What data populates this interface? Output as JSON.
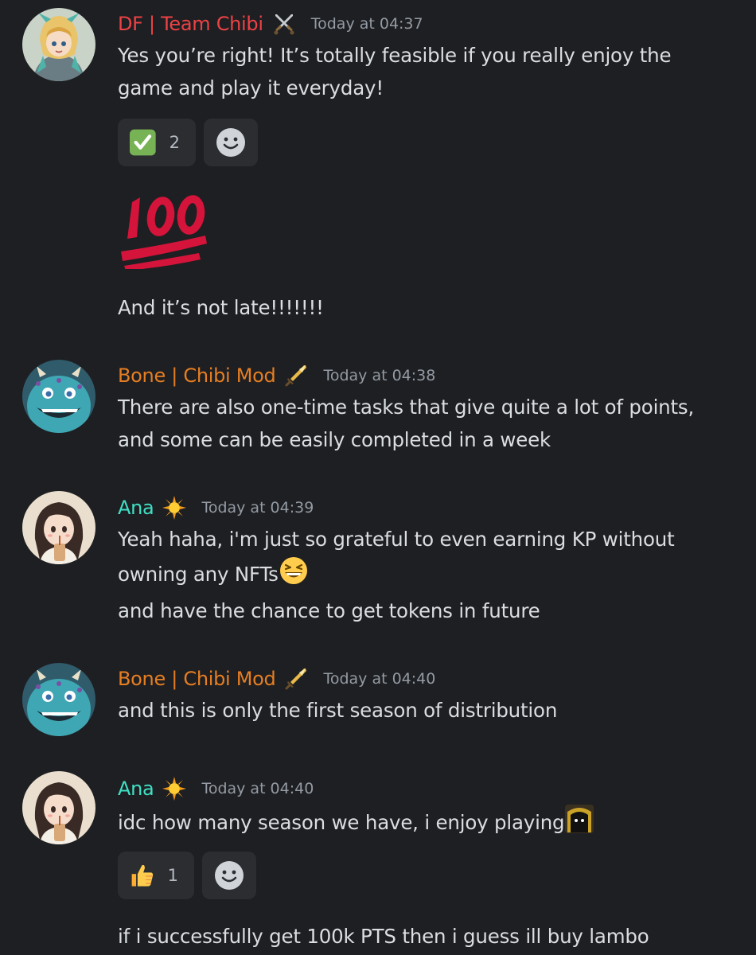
{
  "messages": [
    {
      "username": "DF | Team Chibi",
      "role_icon": "crossed-swords-icon",
      "username_color": "#ed4245",
      "timestamp": "Today at 04:37",
      "avatar": "valkyrie-warrior-avatar",
      "lines": [
        "Yes you’re right! It’s totally feasible if you really enjoy the",
        "game and play it everyday!"
      ],
      "reactions": [
        {
          "emoji": "check-mark-emoji",
          "count": "2"
        }
      ],
      "big_emoji": "hundred-points-emoji",
      "followup": "And it’s not late!!!!!!!"
    },
    {
      "username": "Bone | Chibi Mod",
      "role_icon": "sword-icon",
      "username_color": "#e67e22",
      "timestamp": "Today at 04:38",
      "avatar": "blue-monster-avatar",
      "lines": [
        "There are also one-time tasks that give quite a lot of points,",
        "and some can be easily completed in a week"
      ]
    },
    {
      "username": "Ana",
      "role_icon": "sun-icon",
      "username_color": "#3fe0c5",
      "timestamp": "Today at 04:39",
      "avatar": "anime-girl-avatar",
      "lines": [
        "Yeah haha, i'm just so grateful to even earning KP without",
        "owning any NFTs"
      ],
      "inline_emoji": "grinning-squinting-emoji",
      "followup": "and have the chance to get tokens in future"
    },
    {
      "username": "Bone | Chibi Mod",
      "role_icon": "sword-icon",
      "username_color": "#e67e22",
      "timestamp": "Today at 04:40",
      "avatar": "blue-monster-avatar",
      "lines": [
        "and this is only the first season of distribution"
      ]
    },
    {
      "username": "Ana",
      "role_icon": "sun-icon",
      "username_color": "#3fe0c5",
      "timestamp": "Today at 04:40",
      "avatar": "anime-girl-avatar",
      "lines": [
        "idc how many season we have, i enjoy playing"
      ],
      "inline_emoji": "dark-hooded-character-emoji",
      "reactions": [
        {
          "emoji": "thumbs-up-emoji",
          "count": "1"
        }
      ],
      "followup": "if i successfully get 100k PTS then i guess ill buy lambo"
    }
  ],
  "colors": {
    "background": "#1e1f22",
    "text": "#dbdee1",
    "timestamp": "#949ba4",
    "reaction_bg": "#2b2d31"
  }
}
